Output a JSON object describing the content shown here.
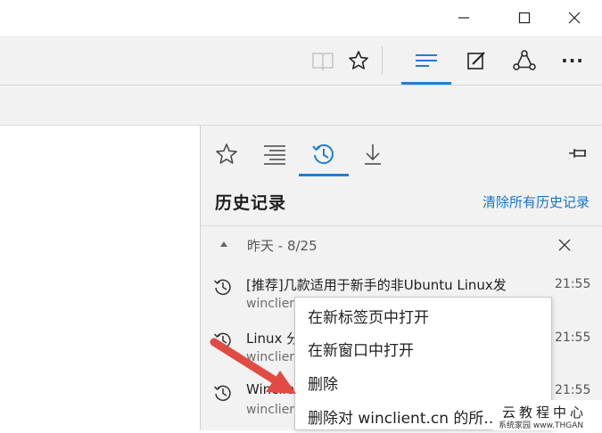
{
  "window": {
    "minimize_icon": "minimize-icon",
    "maximize_icon": "maximize-icon",
    "close_icon": "close-icon"
  },
  "toolbar": {
    "icons": [
      "reading-view-icon",
      "favorite-star-icon",
      "hub-icon",
      "web-note-icon",
      "share-icon",
      "more-icon"
    ],
    "more_label": "···"
  },
  "hub": {
    "tabs": [
      "favorites-tab",
      "reading-list-tab",
      "history-tab",
      "downloads-tab"
    ],
    "active_tab": "history",
    "title": "历史记录",
    "clear_link": "清除所有历史记录",
    "group_label": "昨天 - 8/25",
    "items": [
      {
        "title": "[推荐]几款适用于新手的非Ubuntu Linux发",
        "domain": "winclient",
        "time": "21:55"
      },
      {
        "title": "Linux 分",
        "domain": "winclier",
        "time": "21:55"
      },
      {
        "title": "Winclie",
        "domain": "winclier",
        "time": "21:55"
      }
    ]
  },
  "context_menu": {
    "items": [
      "在新标签页中打开",
      "在新窗口中打开",
      "删除",
      "删除对 winclient.cn 的所..."
    ]
  },
  "watermark": {
    "main": "云教程中心",
    "sub": "系统家园 www.THGAN"
  },
  "colors": {
    "accent": "#1f7fcf",
    "link": "#1a73c9",
    "arrow": "#e24a44",
    "panel": "#f2f2f2"
  }
}
